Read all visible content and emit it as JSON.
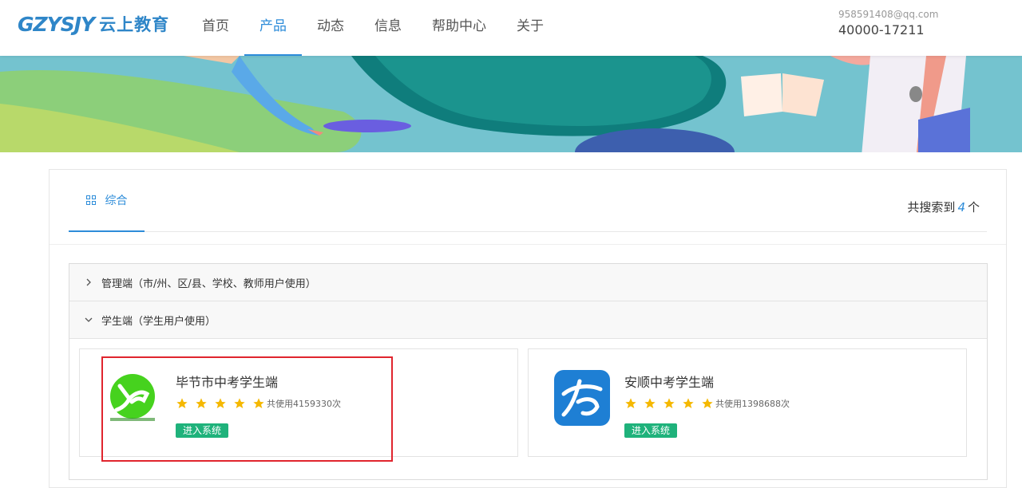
{
  "header": {
    "logo_mark": "GZYSJY",
    "logo_text": "云上教育",
    "nav": [
      "首页",
      "产品",
      "动态",
      "信息",
      "帮助中心",
      "关于"
    ],
    "active_nav_index": 1,
    "email": "958591408@qq.com",
    "phone": "40000-17211"
  },
  "search": {
    "tab_label": "综合",
    "count_prefix": "共搜索到",
    "count": "4",
    "count_suffix": "个"
  },
  "groups": [
    {
      "label": "管理端（市/州、区/县、学校、教师用户使用）",
      "expanded": false
    },
    {
      "label": "学生端（学生用户使用）",
      "expanded": true
    }
  ],
  "products": [
    {
      "name": "毕节市中考学生端",
      "rating": 5,
      "usage": "共使用4159330次",
      "button": "进入系统",
      "logo_color": "#46d21e"
    },
    {
      "name": "安顺中考学生端",
      "rating": 5,
      "usage": "共使用1398688次",
      "button": "进入系统",
      "logo_color": "#1e7fd4"
    }
  ],
  "colors": {
    "accent": "#2d8cd9",
    "button_green": "#1fb27b",
    "star": "#f5b800",
    "highlight": "#e0252e"
  }
}
